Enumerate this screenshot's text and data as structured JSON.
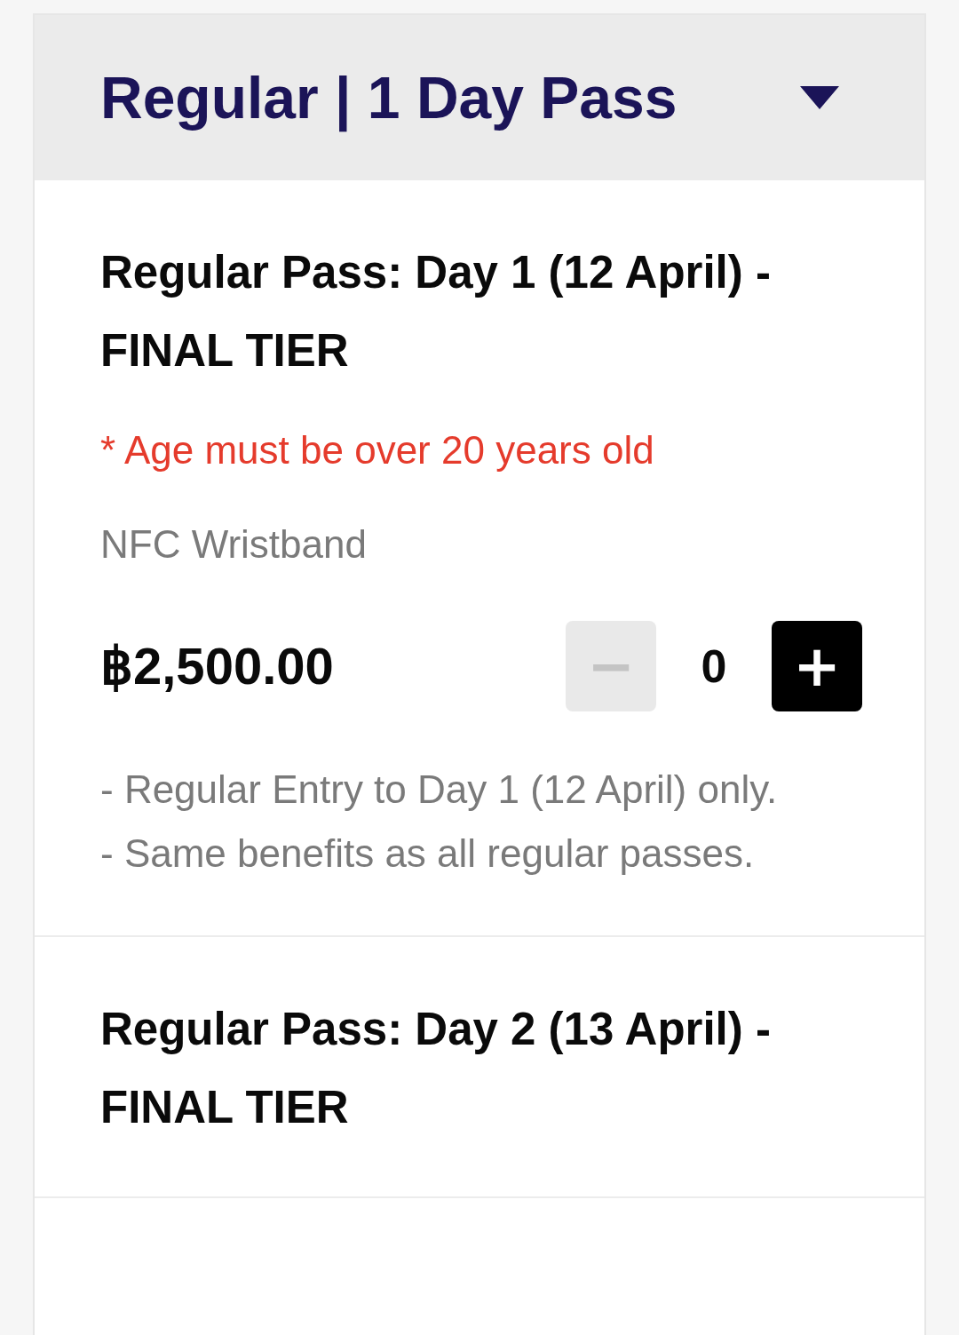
{
  "section": {
    "title": "Regular | 1 Day Pass",
    "expanded": true
  },
  "items": [
    {
      "title": "Regular Pass: Day 1 (12 April) - FINAL TIER",
      "note": "* Age must be over 20 years old",
      "subtitle": "NFC Wristband",
      "price": "฿2,500.00",
      "stepper": {
        "minus": {
          "label": "−",
          "disabled": true
        },
        "quantity": "0",
        "plus": {
          "label": "+",
          "disabled": false
        }
      },
      "description": [
        "- Regular Entry to Day 1 (12 April) only.",
        "- Same benefits as all regular passes."
      ]
    },
    {
      "title": "Regular Pass: Day 2 (13 April) - FINAL TIER"
    }
  ]
}
